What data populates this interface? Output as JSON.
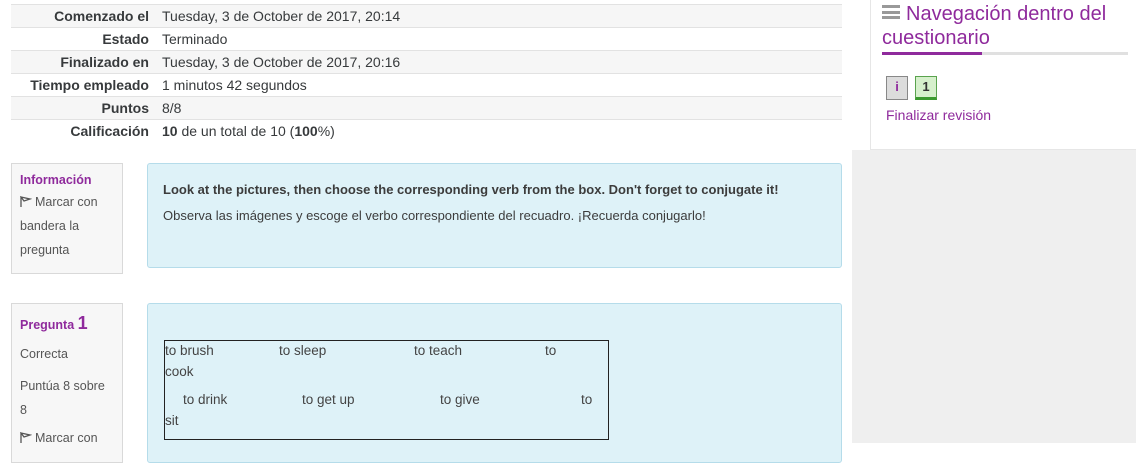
{
  "summary": [
    {
      "label": "Comenzado el",
      "value": "Tuesday, 3 de October de 2017, 20:14"
    },
    {
      "label": "Estado",
      "value": "Terminado"
    },
    {
      "label": "Finalizado en",
      "value": "Tuesday, 3 de October de 2017, 20:16"
    },
    {
      "label": "Tiempo empleado",
      "value": "1 minutos 42 segundos"
    },
    {
      "label": "Puntos",
      "value": "8/8"
    },
    {
      "label": "Calificación",
      "grade": "10",
      "mid": " de un total de 10 (",
      "pct": "100",
      "end": "%)"
    }
  ],
  "info_question": {
    "title": "Información",
    "flag_label": "Marcar con bandera la pregunta",
    "instruction_en": "Look at the pictures, then choose the corresponding verb from the box. Don't forget to conjugate it!",
    "instruction_es": "Observa las imágenes y escoge el verbo correspondiente del recuadro. ¡Recuerda conjugarlo!"
  },
  "question1": {
    "label": "Pregunta",
    "number": "1",
    "status": "Correcta",
    "score": "Puntúa 8 sobre 8",
    "flag_label": "Marcar con",
    "words": [
      "to brush",
      "to sleep",
      "to teach",
      "to",
      "cook",
      "to drink",
      "to get up",
      "to give",
      "to",
      "sit"
    ]
  },
  "nav": {
    "title": "Navegación dentro del cuestionario",
    "info_button": "i",
    "q1_button": "1",
    "finish_link": "Finalizar revisión"
  },
  "colors": {
    "accent": "#8f2a9c",
    "question_bg": "#def2f8",
    "correct_green": "#3b9a2f"
  }
}
